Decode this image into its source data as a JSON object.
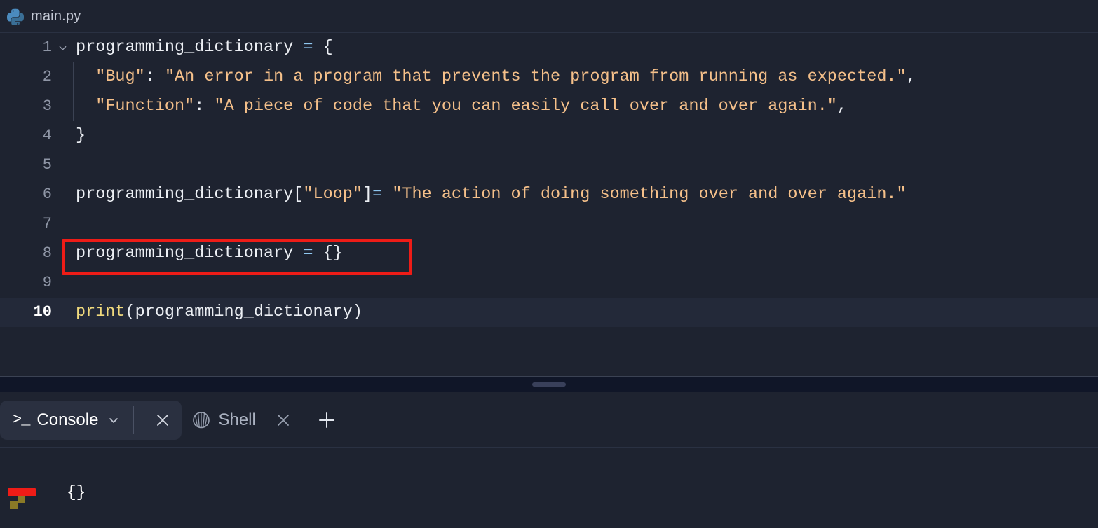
{
  "editor": {
    "tab": {
      "icon": "python-logo-icon",
      "filename": "main.py"
    },
    "lines": [
      {
        "number": "1",
        "fold": true,
        "tokens": [
          {
            "cls": "t-plain",
            "text": "programming_dictionary "
          },
          {
            "cls": "t-op",
            "text": "="
          },
          {
            "cls": "t-plain",
            "text": " {"
          }
        ]
      },
      {
        "number": "2",
        "fold": false,
        "tokens": [
          {
            "cls": "t-plain",
            "text": "  "
          },
          {
            "cls": "t-str",
            "text": "\"Bug\""
          },
          {
            "cls": "t-punc",
            "text": ": "
          },
          {
            "cls": "t-str",
            "text": "\"An error in a program that prevents the program from running as expected.\""
          },
          {
            "cls": "t-punc",
            "text": ","
          }
        ]
      },
      {
        "number": "3",
        "fold": false,
        "tokens": [
          {
            "cls": "t-plain",
            "text": "  "
          },
          {
            "cls": "t-str",
            "text": "\"Function\""
          },
          {
            "cls": "t-punc",
            "text": ": "
          },
          {
            "cls": "t-str",
            "text": "\"A piece of code that you can easily call over and over again.\""
          },
          {
            "cls": "t-punc",
            "text": ","
          }
        ]
      },
      {
        "number": "4",
        "fold": false,
        "tokens": [
          {
            "cls": "t-plain",
            "text": "}"
          }
        ]
      },
      {
        "number": "5",
        "fold": false,
        "tokens": []
      },
      {
        "number": "6",
        "fold": false,
        "tokens": [
          {
            "cls": "t-plain",
            "text": "programming_dictionary["
          },
          {
            "cls": "t-str",
            "text": "\"Loop\""
          },
          {
            "cls": "t-plain",
            "text": "]"
          },
          {
            "cls": "t-op",
            "text": "="
          },
          {
            "cls": "t-plain",
            "text": " "
          },
          {
            "cls": "t-str",
            "text": "\"The action of doing something over and over again.\""
          }
        ]
      },
      {
        "number": "7",
        "fold": false,
        "tokens": []
      },
      {
        "number": "8",
        "fold": false,
        "tokens": [
          {
            "cls": "t-plain",
            "text": "programming_dictionary "
          },
          {
            "cls": "t-op",
            "text": "="
          },
          {
            "cls": "t-plain",
            "text": " {}"
          }
        ]
      },
      {
        "number": "9",
        "fold": false,
        "tokens": []
      },
      {
        "number": "10",
        "fold": false,
        "active": true,
        "tokens": [
          {
            "cls": "t-fn",
            "text": "print"
          },
          {
            "cls": "t-plain",
            "text": "(programming_dictionary)"
          }
        ]
      }
    ],
    "annotation": {
      "color": "#ee1c17",
      "target_line": "8",
      "target_text": "programming_dictionary = {}"
    }
  },
  "console": {
    "tabs": [
      {
        "id": "console",
        "label": "Console",
        "icon": "terminal-prompt-icon",
        "active": true,
        "has_chevron": true,
        "closable": true
      },
      {
        "id": "shell",
        "label": "Shell",
        "icon": "seashell-icon",
        "active": false,
        "has_chevron": false,
        "closable": true
      }
    ],
    "add_tab_label": "+",
    "output": "{}"
  },
  "colors": {
    "editor_bg": "#1e2330",
    "active_line_bg": "#232939",
    "splitter_bg": "#101628",
    "accent_red": "#ee1c17",
    "string": "#f5c08a",
    "operator": "#8fc7f0",
    "function": "#f0d97d",
    "text": "#eceff4",
    "gutter": "#8f96a6"
  }
}
